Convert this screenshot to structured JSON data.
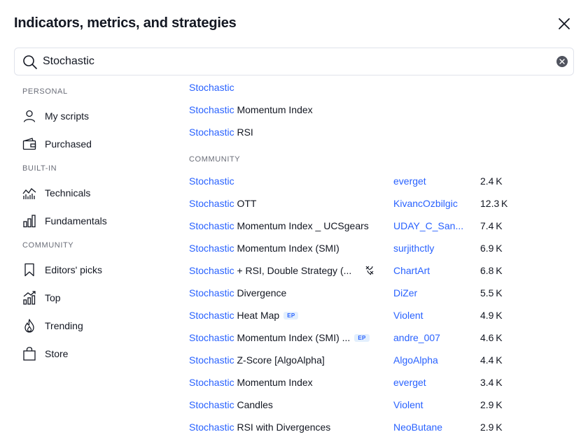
{
  "dialog": {
    "title": "Indicators, metrics, and strategies"
  },
  "search": {
    "value": "Stochastic",
    "placeholder": "Search"
  },
  "sidebar": {
    "sections": [
      {
        "label": "PERSONAL",
        "items": [
          {
            "label": "My scripts",
            "icon": "user-icon"
          },
          {
            "label": "Purchased",
            "icon": "wallet-icon"
          }
        ]
      },
      {
        "label": "BUILT-IN",
        "items": [
          {
            "label": "Technicals",
            "icon": "technicals-chart-icon"
          },
          {
            "label": "Fundamentals",
            "icon": "bar-chart-icon"
          }
        ]
      },
      {
        "label": "COMMUNITY",
        "items": [
          {
            "label": "Editors' picks",
            "icon": "bookmark-icon"
          },
          {
            "label": "Top",
            "icon": "top-chart-icon"
          },
          {
            "label": "Trending",
            "icon": "flame-icon"
          },
          {
            "label": "Store",
            "icon": "shopping-bag-icon"
          }
        ]
      }
    ]
  },
  "builtin_results": [
    {
      "highlight": "Stochastic",
      "rest": ""
    },
    {
      "highlight": "Stochastic",
      "rest": " Momentum Index"
    },
    {
      "highlight": "Stochastic",
      "rest": " RSI"
    }
  ],
  "community_label": "COMMUNITY",
  "community_results": [
    {
      "highlight": "Stochastic",
      "rest": "",
      "author": "everget",
      "count": "2.4 K"
    },
    {
      "highlight": "Stochastic",
      "rest": " OTT",
      "author": "KivancOzbilgic",
      "count": "12.3 K"
    },
    {
      "highlight": "Stochastic",
      "rest": " Momentum Index _ UCSgears",
      "author": "UDAY_C_San...",
      "count": "7.4 K"
    },
    {
      "highlight": "Stochastic",
      "rest": " Momentum Index (SMI)",
      "author": "surjithctly",
      "count": "6.9 K"
    },
    {
      "highlight": "Stochastic",
      "rest": " + RSI, Double Strategy (...",
      "author": "ChartArt",
      "count": "6.8 K",
      "strategy_icon": "strategy-icon"
    },
    {
      "highlight": "Stochastic",
      "rest": " Divergence",
      "author": "DiZer",
      "count": "5.5 K"
    },
    {
      "highlight": "Stochastic",
      "rest": " Heat Map",
      "badge": "EP",
      "author": "Violent",
      "count": "4.9 K"
    },
    {
      "highlight": "Stochastic",
      "rest": " Momentum Index (SMI) ...",
      "badge": "EP",
      "author": "andre_007",
      "count": "4.6 K"
    },
    {
      "highlight": "Stochastic",
      "rest": " Z-Score [AlgoAlpha]",
      "author": "AlgoAlpha",
      "count": "4.4 K"
    },
    {
      "highlight": "Stochastic",
      "rest": " Momentum Index",
      "author": "everget",
      "count": "3.4 K"
    },
    {
      "highlight": "Stochastic",
      "rest": " Candles",
      "author": "Violent",
      "count": "2.9 K"
    },
    {
      "highlight": "Stochastic",
      "rest": " RSI with Divergences",
      "author": "NeoButane",
      "count": "2.9 K"
    }
  ],
  "colors": {
    "accent": "#2962ff",
    "text": "#131722",
    "muted": "#6a6d78",
    "border": "#e0e3eb",
    "badge_bg": "#e3effd"
  }
}
